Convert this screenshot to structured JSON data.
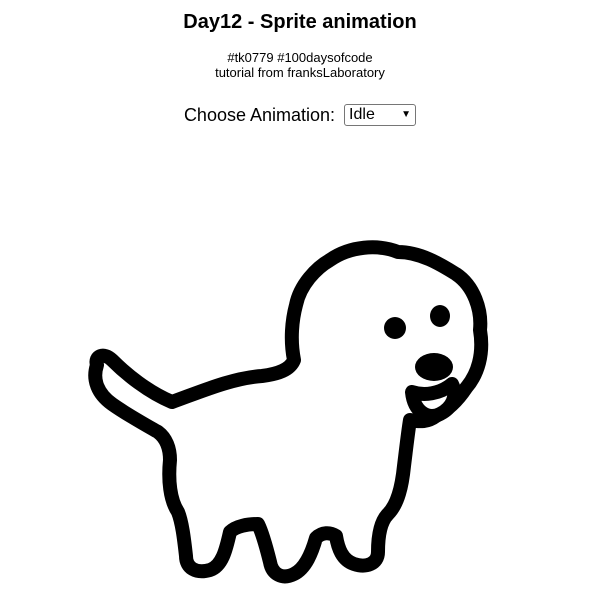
{
  "page": {
    "title": "Day12 - Sprite animation",
    "subtitle_line1": "#tk0779 #100daysofcode",
    "subtitle_line2": "tutorial from franksLaboratory"
  },
  "controls": {
    "label": "Choose Animation:",
    "selected": "Idle",
    "chevron_icon": "chevron-down-icon"
  },
  "sprite": {
    "name": "dog-sprite",
    "outline_color": "#000000",
    "fill_color": "#ffffff"
  }
}
